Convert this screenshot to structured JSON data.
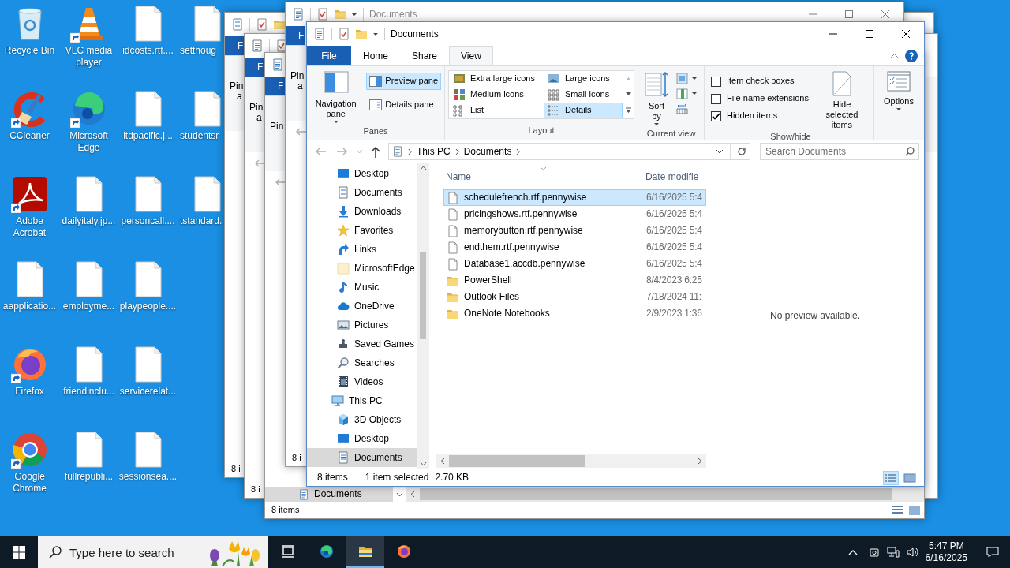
{
  "desktop_icons": [
    {
      "label": "Recycle Bin",
      "kind": "recycle"
    },
    {
      "label": "CCleaner",
      "kind": "ccleaner",
      "shortcut": true
    },
    {
      "label": "Adobe Acrobat",
      "kind": "acrobat",
      "shortcut": true
    },
    {
      "label": "aapplicatio...",
      "kind": "file"
    },
    {
      "label": "Firefox",
      "kind": "firefox",
      "shortcut": true
    },
    {
      "label": "Google Chrome",
      "kind": "chrome",
      "shortcut": true
    },
    {
      "label": "VLC media player",
      "kind": "vlc",
      "shortcut": true
    },
    {
      "label": "Microsoft Edge",
      "kind": "edge",
      "shortcut": true
    },
    {
      "label": "dailyitaly.jp...",
      "kind": "file"
    },
    {
      "label": "employme...",
      "kind": "file"
    },
    {
      "label": "friendinclu...",
      "kind": "file"
    },
    {
      "label": "fullrepubli...",
      "kind": "file"
    },
    {
      "label": "idcosts.rtf....",
      "kind": "file"
    },
    {
      "label": "ltdpacific.j...",
      "kind": "file"
    },
    {
      "label": "personcall....",
      "kind": "file"
    },
    {
      "label": "playpeople....",
      "kind": "file"
    },
    {
      "label": "servicerelat...",
      "kind": "file"
    },
    {
      "label": "sessionsea....",
      "kind": "file"
    },
    {
      "label": "setthoug",
      "kind": "file"
    },
    {
      "label": "studentsr",
      "kind": "file"
    },
    {
      "label": "tstandard.",
      "kind": "file"
    }
  ],
  "back_windows": [
    {
      "tab": "F",
      "pin": "Pin",
      "pin_sub": "a",
      "status": "8 i"
    },
    {
      "tab": "F",
      "pin": "Pin",
      "pin_sub": "a",
      "status": "8 i",
      "nav_arrow": true
    },
    {
      "tab": "F",
      "pin": "Pin",
      "status": "8 items",
      "nav_item": "Documents",
      "nav_arrow": true
    },
    {
      "title": "Documents",
      "tab": "F",
      "pin": "Pin",
      "pin_sub": "a",
      "status": "8 i",
      "nav_arrow": true
    }
  ],
  "explorer": {
    "title": "Documents",
    "ribbon_tabs": [
      {
        "label": "File",
        "kind": "file",
        "selected": false
      },
      {
        "label": "Home",
        "kind": "tab",
        "selected": false
      },
      {
        "label": "Share",
        "kind": "tab",
        "selected": false
      },
      {
        "label": "View",
        "kind": "tab",
        "selected": true
      }
    ],
    "panes_group": {
      "title": "Panes",
      "items": [
        {
          "label": "Navigation pane",
          "kind": "large",
          "selected": false
        },
        {
          "label": "Preview pane",
          "kind": "preview",
          "selected": true
        },
        {
          "label": "Details pane",
          "kind": "details",
          "selected": false
        }
      ]
    },
    "layout_group": {
      "title": "Layout",
      "items": [
        {
          "label": "Extra large icons",
          "selected": false
        },
        {
          "label": "Large icons",
          "selected": false
        },
        {
          "label": "Medium icons",
          "selected": false
        },
        {
          "label": "Small icons",
          "selected": false
        },
        {
          "label": "List",
          "selected": false
        },
        {
          "label": "Details",
          "selected": true
        }
      ]
    },
    "current_view_group": {
      "title": "Current view",
      "sort_label": "Sort by"
    },
    "show_hide_group": {
      "title": "Show/hide",
      "checkboxes": [
        {
          "label": "Item check boxes",
          "checked": false
        },
        {
          "label": "File name extensions",
          "checked": false
        },
        {
          "label": "Hidden items",
          "checked": true
        }
      ],
      "hide_button": "Hide selected items"
    },
    "options_button": "Options",
    "address": {
      "crumbs": [
        "This PC",
        "Documents"
      ]
    },
    "search": {
      "placeholder": "Search Documents"
    },
    "nav_tree": [
      {
        "label": "Desktop",
        "selected": false
      },
      {
        "label": "Documents",
        "selected": false
      },
      {
        "label": "Downloads",
        "selected": false
      },
      {
        "label": "Favorites",
        "selected": false
      },
      {
        "label": "Links",
        "selected": false
      },
      {
        "label": "MicrosoftEdge",
        "selected": false
      },
      {
        "label": "Music",
        "selected": false
      },
      {
        "label": "OneDrive",
        "selected": false
      },
      {
        "label": "Pictures",
        "selected": false
      },
      {
        "label": "Saved Games",
        "selected": false
      },
      {
        "label": "Searches",
        "selected": false
      },
      {
        "label": "Videos",
        "selected": false
      },
      {
        "label": "This PC",
        "selected": false,
        "children": [
          {
            "label": "3D Objects",
            "selected": false
          },
          {
            "label": "Desktop",
            "selected": false
          },
          {
            "label": "Documents",
            "selected": true
          }
        ]
      }
    ],
    "file_list": {
      "columns": [
        "Name",
        "Date modifie"
      ],
      "rows": [
        {
          "name": "schedulefrench.rtf.pennywise",
          "date": "6/16/2025 5:4",
          "kind": "file",
          "selected": true
        },
        {
          "name": "pricingshows.rtf.pennywise",
          "date": "6/16/2025 5:4",
          "kind": "file",
          "selected": false
        },
        {
          "name": "memorybutton.rtf.pennywise",
          "date": "6/16/2025 5:4",
          "kind": "file",
          "selected": false
        },
        {
          "name": "endthem.rtf.pennywise",
          "date": "6/16/2025 5:4",
          "kind": "file",
          "selected": false
        },
        {
          "name": "Database1.accdb.pennywise",
          "date": "6/16/2025 5:4",
          "kind": "file",
          "selected": false
        },
        {
          "name": "PowerShell",
          "date": "8/4/2023 6:25",
          "kind": "folder",
          "selected": false
        },
        {
          "name": "Outlook Files",
          "date": "7/18/2024 11:",
          "kind": "folder",
          "selected": false
        },
        {
          "name": "OneNote Notebooks",
          "date": "2/9/2023 1:36",
          "kind": "folder",
          "selected": false
        }
      ]
    },
    "preview_text": "No preview available.",
    "status": {
      "count": "8 items",
      "selection": "1 item selected",
      "size": "2.70 KB"
    },
    "view_buttons": [
      {
        "kind": "details",
        "selected": true
      },
      {
        "kind": "large",
        "selected": false
      }
    ]
  },
  "taskbar": {
    "search_placeholder": "Type here to search",
    "apps": [
      {
        "kind": "taskview",
        "active": false
      },
      {
        "kind": "edge",
        "active": false
      },
      {
        "kind": "explorer",
        "active": true
      },
      {
        "kind": "firefox",
        "active": false
      }
    ],
    "time": "5:47 PM",
    "date": "6/16/2025"
  }
}
